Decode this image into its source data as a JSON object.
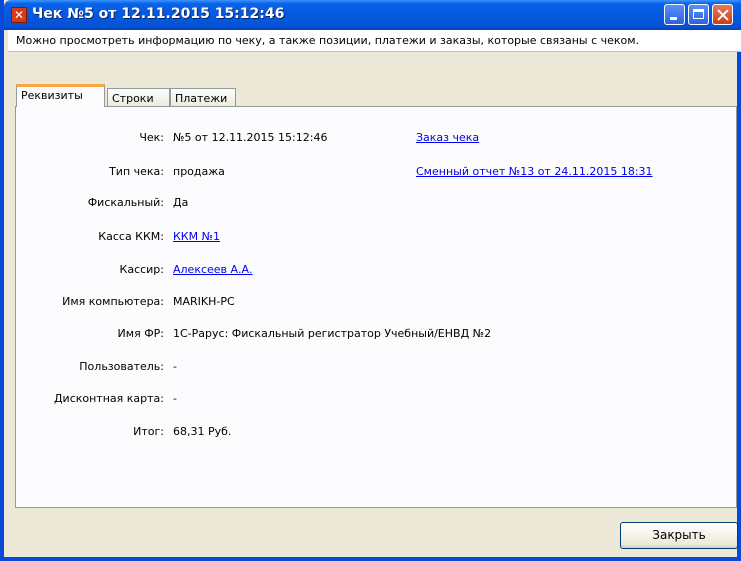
{
  "window": {
    "title": "Чек №5 от 12.11.2015 15:12:46",
    "app_icon": "app-icon",
    "accent_color": "#0a48d8"
  },
  "hint": "Можно просмотреть информацию по чеку, а также позиции, платежи и заказы, которые связаны с чеком.",
  "tabs": [
    {
      "label": "Реквизиты",
      "active": true
    },
    {
      "label": "Строки",
      "active": false
    },
    {
      "label": "Платежи",
      "active": false
    }
  ],
  "fields": {
    "receipt": {
      "label": "Чек:",
      "value": "№5 от 12.11.2015 15:12:46"
    },
    "type": {
      "label": "Тип чека:",
      "value": "продажа"
    },
    "fiscal": {
      "label": "Фискальный:",
      "value": "Да"
    },
    "register": {
      "label": "Касса ККМ:",
      "value": "ККМ №1"
    },
    "cashier": {
      "label": "Кассир:",
      "value": "Алексеев А.А."
    },
    "computer": {
      "label": "Имя компьютера:",
      "value": "MARIKH-PC"
    },
    "fr_name": {
      "label": "Имя ФР:",
      "value": "1С-Рарус: Фискальный регистратор Учебный/ЕНВД №2"
    },
    "user": {
      "label": "Пользователь:",
      "value": "-"
    },
    "discount_card": {
      "label": "Дисконтная карта:",
      "value": "-"
    },
    "total": {
      "label": "Итог:",
      "value": "68,31 Руб."
    }
  },
  "links": {
    "order": "Заказ чека",
    "shift_report": "Сменный отчет №13 от 24.11.2015 18:31"
  },
  "buttons": {
    "close": "Закрыть"
  }
}
